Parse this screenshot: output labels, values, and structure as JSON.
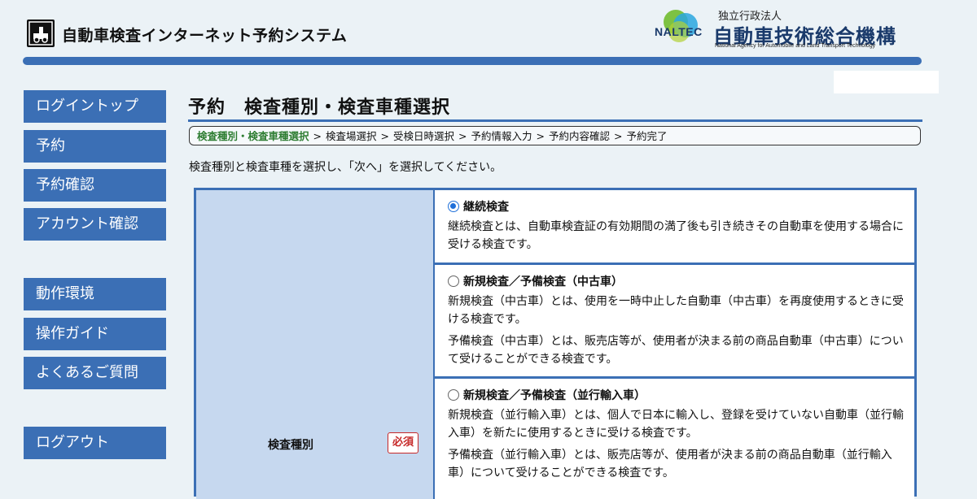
{
  "app": {
    "title": "自動車検査インターネット予約システム"
  },
  "organization": {
    "mark": "NALTEC",
    "type": "独立行政法人",
    "name": "自動車技術総合機構",
    "name_en": "National Agency for Automobile and Land Transport Technology"
  },
  "sidebar": {
    "items": [
      {
        "label": "ログイントップ"
      },
      {
        "label": "予約"
      },
      {
        "label": "予約確認"
      },
      {
        "label": "アカウント確認"
      },
      {
        "label": "動作環境"
      },
      {
        "label": "操作ガイド"
      },
      {
        "label": "よくあるご質問"
      },
      {
        "label": "ログアウト"
      }
    ]
  },
  "page": {
    "title": "予約　検査種別・検査車種選択",
    "breadcrumb": [
      "検査種別・検査車種選択",
      "検査場選択",
      "受検日時選択",
      "予約情報入力",
      "予約内容確認",
      "予約完了"
    ],
    "breadcrumb_separator": ">",
    "instruction": "検査種別と検査車種を選択し、「次へ」を選択してください。"
  },
  "form": {
    "field_label": "検査種別",
    "required_label": "必須",
    "options": [
      {
        "title": "継続検査",
        "checked": true,
        "desc": [
          "継続検査とは、自動車検査証の有効期間の満了後も引き続きその自動車を使用する場合に受ける検査です。"
        ]
      },
      {
        "title": "新規検査／予備検査（中古車）",
        "checked": false,
        "desc": [
          "新規検査（中古車）とは、使用を一時中止した自動車（中古車）を再度使用するときに受ける検査です。",
          "予備検査（中古車）とは、販売店等が、使用者が決まる前の商品自動車（中古車）について受けることができる検査です。"
        ]
      },
      {
        "title": "新規検査／予備検査（並行輸入車）",
        "checked": false,
        "desc": [
          "新規検査（並行輸入車）とは、個人で日本に輸入し、登録を受けていない自動車（並行輸入車）を新たに使用するときに受ける検査です。",
          "予備検査（並行輸入車）とは、販売店等が、使用者が決まる前の商品自動車（並行輸入車）について受けることができる検査です。"
        ]
      }
    ]
  },
  "colors": {
    "background": "#ebf2f6",
    "accent": "#3b6fb5",
    "label_cell": "#c6d8ef",
    "breadcrumb_current": "#2e7d32",
    "required": "#c62828",
    "radio_checked": "#1e6fd9"
  },
  "icons": {
    "app_logo": "car-inspection-logo-icon",
    "org_logo": "naltec-globe-logo"
  }
}
